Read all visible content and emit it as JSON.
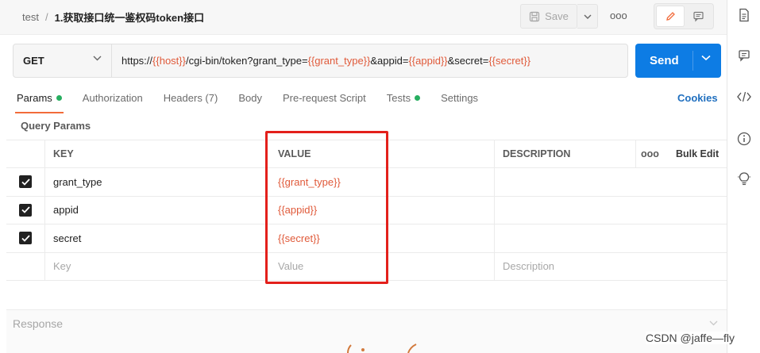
{
  "header": {
    "collection": "test",
    "separator": "/",
    "request_name": "1.获取接口统一鉴权码token接口",
    "save_label": "Save",
    "more_label": "ooo"
  },
  "request": {
    "method": "GET",
    "url_parts": [
      {
        "text": "https://",
        "var": false
      },
      {
        "text": "{{host}}",
        "var": true
      },
      {
        "text": "/cgi-bin/token?grant_type=",
        "var": false
      },
      {
        "text": "{{grant_type}}",
        "var": true
      },
      {
        "text": "&appid=",
        "var": false
      },
      {
        "text": "{{appid}}",
        "var": true
      },
      {
        "text": "&secret=",
        "var": false
      },
      {
        "text": "{{secret}}",
        "var": true
      }
    ],
    "send_label": "Send"
  },
  "tabs": [
    {
      "label": "Params",
      "active": true,
      "dot": true
    },
    {
      "label": "Authorization",
      "active": false,
      "dot": false
    },
    {
      "label": "Headers (7)",
      "active": false,
      "dot": false
    },
    {
      "label": "Body",
      "active": false,
      "dot": false
    },
    {
      "label": "Pre-request Script",
      "active": false,
      "dot": false
    },
    {
      "label": "Tests",
      "active": false,
      "dot": true
    },
    {
      "label": "Settings",
      "active": false,
      "dot": false
    }
  ],
  "cookies_label": "Cookies",
  "query_params": {
    "title": "Query Params",
    "columns": {
      "key": "KEY",
      "value": "VALUE",
      "description": "DESCRIPTION",
      "more": "ooo",
      "bulk_edit": "Bulk Edit"
    },
    "rows": [
      {
        "key": "grant_type",
        "value": "{{grant_type}}",
        "description": "",
        "checked": true
      },
      {
        "key": "appid",
        "value": "{{appid}}",
        "description": "",
        "checked": true
      },
      {
        "key": "secret",
        "value": "{{secret}}",
        "description": "",
        "checked": true
      }
    ],
    "placeholders": {
      "key": "Key",
      "value": "Value",
      "description": "Description"
    }
  },
  "response": {
    "title": "Response"
  },
  "watermark": "CSDN @jaffe—fly",
  "colors": {
    "accent": "#f26b3a",
    "send": "#0d7ce4",
    "variable": "#e05a3a",
    "status_dot": "#27ae60",
    "highlight": "#e3201b",
    "link": "#1f6fbf"
  },
  "rail_icons": [
    "document-icon",
    "comment-icon",
    "code-icon",
    "info-icon",
    "bulb-icon"
  ]
}
